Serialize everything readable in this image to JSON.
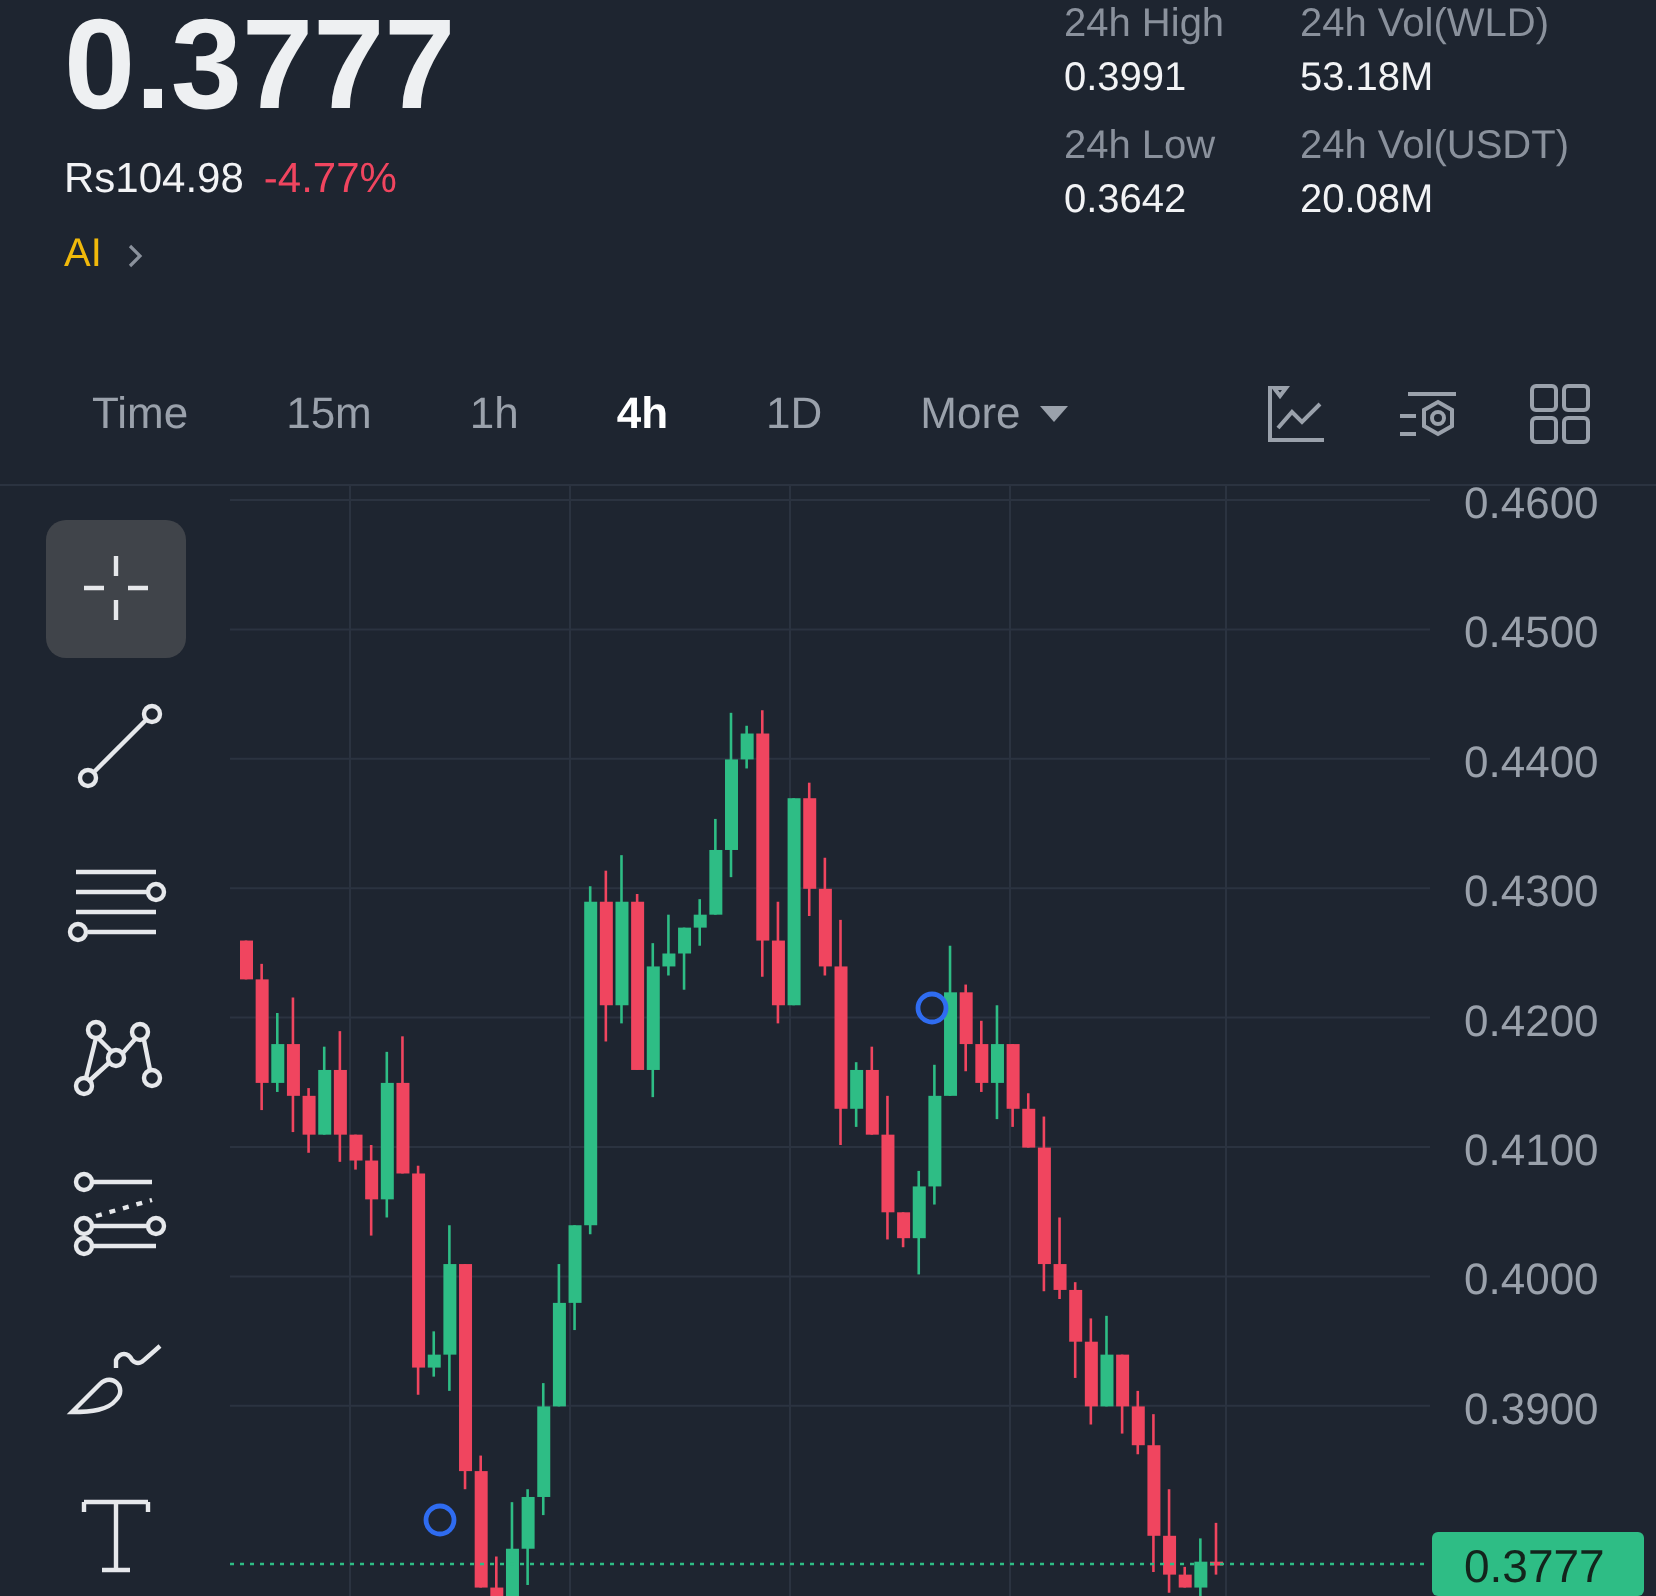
{
  "ticker": {
    "price": "0.3777",
    "fiat_price": "Rs104.98",
    "change": "-4.77%",
    "ai_label": "AI"
  },
  "stats": [
    {
      "label": "24h High",
      "value": "0.3991"
    },
    {
      "label": "24h Vol(WLD)",
      "value": "53.18M"
    },
    {
      "label": "24h Low",
      "value": "0.3642"
    },
    {
      "label": "24h Vol(USDT)",
      "value": "20.08M"
    }
  ],
  "intervals": [
    {
      "label": "Time",
      "selected": false,
      "kind": "plain"
    },
    {
      "label": "15m",
      "selected": false,
      "kind": "plain"
    },
    {
      "label": "1h",
      "selected": false,
      "kind": "plain"
    },
    {
      "label": "4h",
      "selected": true,
      "kind": "plain"
    },
    {
      "label": "1D",
      "selected": false,
      "kind": "plain"
    },
    {
      "label": "More",
      "selected": false,
      "kind": "dropdown"
    }
  ],
  "drawing_tools": [
    {
      "kind": "crosshair",
      "selected": true
    },
    {
      "kind": "trendline",
      "selected": false
    },
    {
      "kind": "channel",
      "selected": false
    },
    {
      "kind": "pattern",
      "selected": false
    },
    {
      "kind": "fib",
      "selected": false
    },
    {
      "kind": "brush",
      "selected": false
    },
    {
      "kind": "text",
      "selected": false
    }
  ],
  "chart": {
    "price_axis": [
      "0.4600",
      "0.4500",
      "0.4400",
      "0.4300",
      "0.4200",
      "0.4100",
      "0.4000",
      "0.3900"
    ],
    "last_price": "0.3777"
  }
}
